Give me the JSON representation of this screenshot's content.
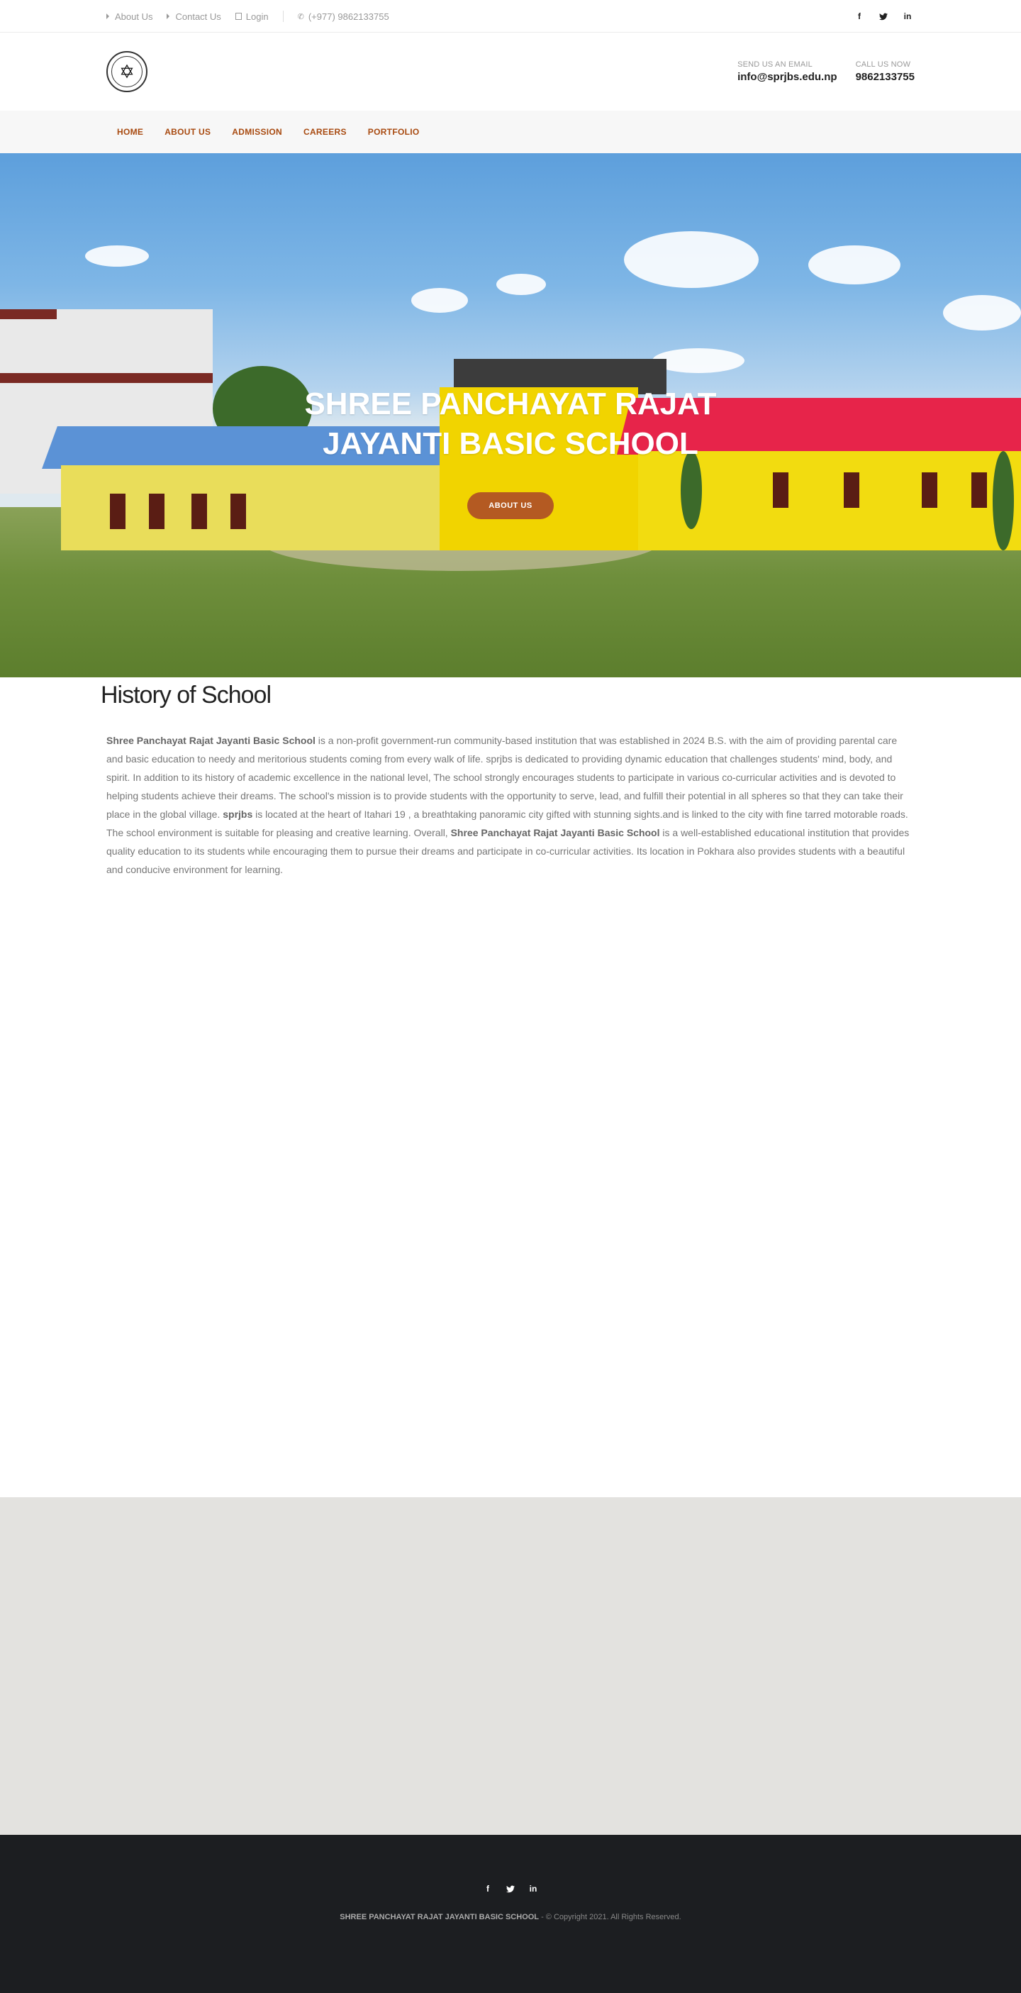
{
  "topbar": {
    "links": [
      {
        "label": "About Us"
      },
      {
        "label": "Contact Us"
      },
      {
        "label": "Login"
      }
    ],
    "phone": "(+977) 9862133755",
    "social": [
      {
        "icon": "facebook-icon",
        "glyph": "f"
      },
      {
        "icon": "twitter-icon",
        "glyph": "t"
      },
      {
        "icon": "linkedin-icon",
        "glyph": "in"
      }
    ]
  },
  "header": {
    "logo_glyph": "✡",
    "email_label": "SEND US AN EMAIL",
    "email": "info@sprjbs.edu.np",
    "call_label": "CALL US NOW",
    "phone": "9862133755"
  },
  "nav": {
    "items": [
      "HOME",
      "ABOUT US",
      "ADMISSION",
      "CAREERS",
      "PORTFOLIO"
    ]
  },
  "hero": {
    "title_line1": "SHREE PANCHAYAT RAJAT",
    "title_line2": "JAYANTI BASIC SCHOOL",
    "button": "ABOUT US"
  },
  "history": {
    "title": "History of School",
    "school_name": "Shree Panchayat Rajat Jayanti Basic School",
    "p1": " is a non-profit government-run community-based institution that was established in 2024 B.S. with the aim of providing parental care and basic education to needy and meritorious students coming from every walk of life. sprjbs is dedicated to providing dynamic education that challenges students' mind, body, and spirit. In addition to its history of academic excellence in the national level, The school strongly encourages students to participate in various co-curricular activities and is devoted to helping students achieve their dreams. The school's mission is to provide students with the opportunity to serve, lead, and fulfill their potential in all spheres so that they can take their place in the global village. ",
    "short_name": "sprjbs",
    "p2": " is located at the heart of Itahari 19 , a breathtaking panoramic city gifted with stunning sights.and is linked to the city with fine tarred motorable roads. The school environment is suitable for pleasing and creative learning. Overall, ",
    "p3": " is a well-established educational institution that provides quality education to its students while encouraging them to pursue their dreams and participate in co-curricular activities. Its location in Pokhara also provides students with a beautiful and conducive environment for learning."
  },
  "footer": {
    "social": [
      {
        "icon": "facebook-icon",
        "glyph": "f"
      },
      {
        "icon": "twitter-icon",
        "glyph": "t"
      },
      {
        "icon": "linkedin-icon",
        "glyph": "in"
      }
    ],
    "school": "SHREE PANCHAYAT RAJAT JAYANTI BASIC SCHOOL",
    "copyright": " - © Copyright 2021. All Rights Reserved."
  }
}
